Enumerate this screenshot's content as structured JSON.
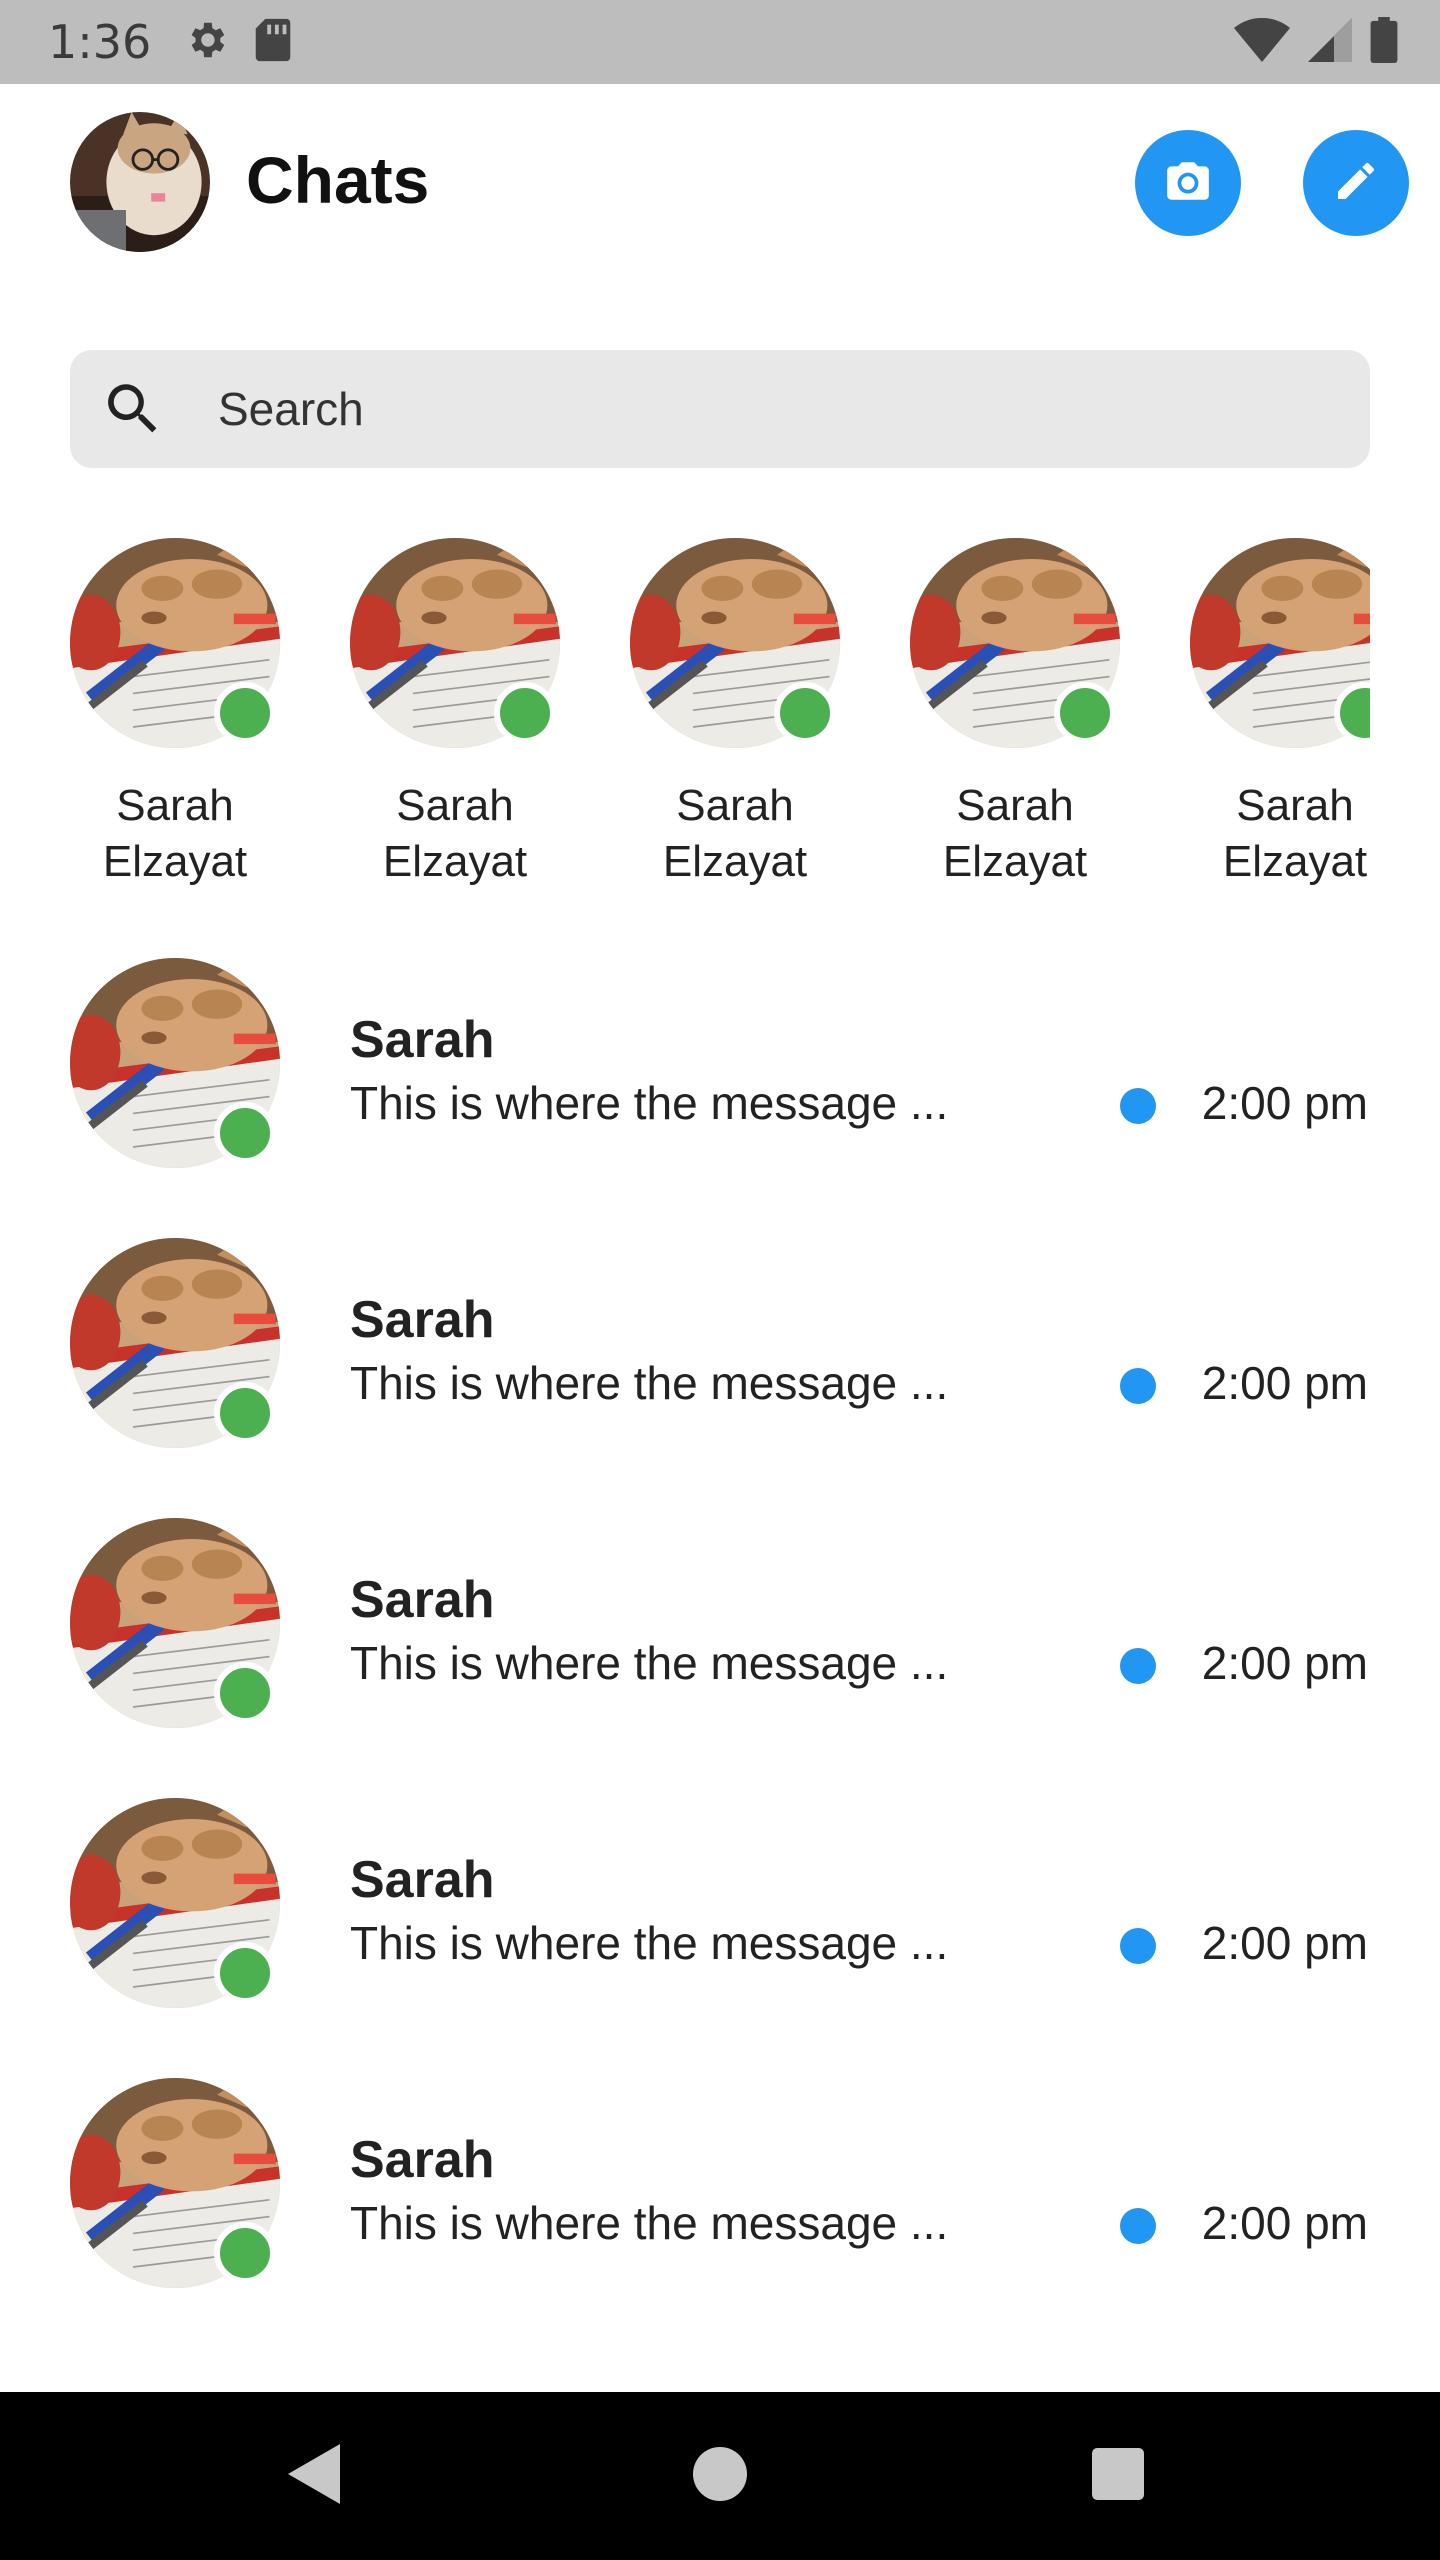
{
  "status_bar": {
    "time": "1:36",
    "icons": [
      "settings-icon",
      "sd-card-icon",
      "wifi-icon",
      "signal-icon",
      "battery-icon"
    ]
  },
  "header": {
    "title": "Chats",
    "actions": [
      "camera-icon",
      "pencil-icon"
    ],
    "accent_color": "#2196f3"
  },
  "search": {
    "placeholder": "Search"
  },
  "stories": [
    {
      "name": "Sarah Elzayat",
      "online": true
    },
    {
      "name": "Sarah Elzayat",
      "online": true
    },
    {
      "name": "Sarah Elzayat",
      "online": true
    },
    {
      "name": "Sarah Elzayat",
      "online": true
    },
    {
      "name": "Sarah Elzayat",
      "online": true
    }
  ],
  "chats": [
    {
      "name": "Sarah",
      "preview": "This is where the message ...",
      "time": "2:00 pm",
      "unread": true,
      "online": true
    },
    {
      "name": "Sarah",
      "preview": "This is where the message ...",
      "time": "2:00 pm",
      "unread": true,
      "online": true
    },
    {
      "name": "Sarah",
      "preview": "This is where the message ...",
      "time": "2:00 pm",
      "unread": true,
      "online": true
    },
    {
      "name": "Sarah",
      "preview": "This is where the message ...",
      "time": "2:00 pm",
      "unread": true,
      "online": true
    },
    {
      "name": "Sarah",
      "preview": "This is where the message ...",
      "time": "2:00 pm",
      "unread": true,
      "online": true
    }
  ],
  "colors": {
    "online": "#4caf50",
    "unread": "#2196f3",
    "status_bar": "#bdbdbd",
    "nav_bar": "#000000"
  },
  "nav": [
    "back-icon",
    "home-icon",
    "recents-icon"
  ]
}
